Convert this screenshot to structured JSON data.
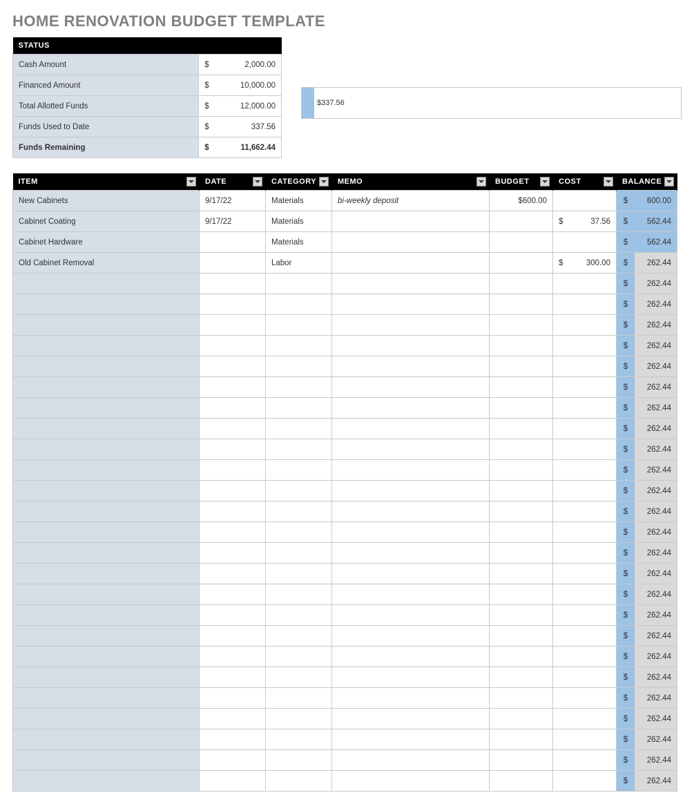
{
  "title": "HOME RENOVATION BUDGET TEMPLATE",
  "status": {
    "header": "STATUS",
    "rows": [
      {
        "label": "Cash Amount",
        "cur": "$",
        "value": "2,000.00",
        "bold": false
      },
      {
        "label": "Financed Amount",
        "cur": "$",
        "value": "10,000.00",
        "bold": false
      },
      {
        "label": "Total Allotted Funds",
        "cur": "$",
        "value": "12,000.00",
        "bold": false
      },
      {
        "label": "Funds Used to Date",
        "cur": "$",
        "value": "337.56",
        "bold": false
      },
      {
        "label": "Funds Remaining",
        "cur": "$",
        "value": "11,662.44",
        "bold": true
      }
    ]
  },
  "bar": {
    "label": "$337.56"
  },
  "columns": {
    "item": "ITEM",
    "date": "DATE",
    "category": "CATEGORY",
    "memo": "MEMO",
    "budget": "BUDGET",
    "cost": "COST",
    "balance": "BALANCE"
  },
  "rows": [
    {
      "item": "New Cabinets",
      "date": "9/17/22",
      "category": "Materials",
      "memo": "bi-weekly deposit",
      "budget": "$600.00",
      "cost_cur": "",
      "cost": "",
      "bal_cur": "$",
      "balance": "600.00",
      "full": true
    },
    {
      "item": "Cabinet Coating",
      "date": "9/17/22",
      "category": "Materials",
      "memo": "",
      "budget": "",
      "cost_cur": "$",
      "cost": "37.56",
      "bal_cur": "$",
      "balance": "562.44",
      "full": true
    },
    {
      "item": "Cabinet Hardware",
      "date": "",
      "category": "Materials",
      "memo": "",
      "budget": "",
      "cost_cur": "",
      "cost": "",
      "bal_cur": "$",
      "balance": "562.44",
      "full": true
    },
    {
      "item": "Old Cabinet Removal",
      "date": "",
      "category": "Labor",
      "memo": "",
      "budget": "",
      "cost_cur": "$",
      "cost": "300.00",
      "bal_cur": "$",
      "balance": "262.44",
      "full": false
    },
    {
      "item": "",
      "date": "",
      "category": "",
      "memo": "",
      "budget": "",
      "cost_cur": "",
      "cost": "",
      "bal_cur": "$",
      "balance": "262.44",
      "full": false
    },
    {
      "item": "",
      "date": "",
      "category": "",
      "memo": "",
      "budget": "",
      "cost_cur": "",
      "cost": "",
      "bal_cur": "$",
      "balance": "262.44",
      "full": false
    },
    {
      "item": "",
      "date": "",
      "category": "",
      "memo": "",
      "budget": "",
      "cost_cur": "",
      "cost": "",
      "bal_cur": "$",
      "balance": "262.44",
      "full": false
    },
    {
      "item": "",
      "date": "",
      "category": "",
      "memo": "",
      "budget": "",
      "cost_cur": "",
      "cost": "",
      "bal_cur": "$",
      "balance": "262.44",
      "full": false
    },
    {
      "item": "",
      "date": "",
      "category": "",
      "memo": "",
      "budget": "",
      "cost_cur": "",
      "cost": "",
      "bal_cur": "$",
      "balance": "262.44",
      "full": false
    },
    {
      "item": "",
      "date": "",
      "category": "",
      "memo": "",
      "budget": "",
      "cost_cur": "",
      "cost": "",
      "bal_cur": "$",
      "balance": "262.44",
      "full": false
    },
    {
      "item": "",
      "date": "",
      "category": "",
      "memo": "",
      "budget": "",
      "cost_cur": "",
      "cost": "",
      "bal_cur": "$",
      "balance": "262.44",
      "full": false
    },
    {
      "item": "",
      "date": "",
      "category": "",
      "memo": "",
      "budget": "",
      "cost_cur": "",
      "cost": "",
      "bal_cur": "$",
      "balance": "262.44",
      "full": false
    },
    {
      "item": "",
      "date": "",
      "category": "",
      "memo": "",
      "budget": "",
      "cost_cur": "",
      "cost": "",
      "bal_cur": "$",
      "balance": "262.44",
      "full": false
    },
    {
      "item": "",
      "date": "",
      "category": "",
      "memo": "",
      "budget": "",
      "cost_cur": "",
      "cost": "",
      "bal_cur": "$",
      "balance": "262.44",
      "full": false
    },
    {
      "item": "",
      "date": "",
      "category": "",
      "memo": "",
      "budget": "",
      "cost_cur": "",
      "cost": "",
      "bal_cur": "$",
      "balance": "262.44",
      "full": false
    },
    {
      "item": "",
      "date": "",
      "category": "",
      "memo": "",
      "budget": "",
      "cost_cur": "",
      "cost": "",
      "bal_cur": "$",
      "balance": "262.44",
      "full": false
    },
    {
      "item": "",
      "date": "",
      "category": "",
      "memo": "",
      "budget": "",
      "cost_cur": "",
      "cost": "",
      "bal_cur": "$",
      "balance": "262.44",
      "full": false
    },
    {
      "item": "",
      "date": "",
      "category": "",
      "memo": "",
      "budget": "",
      "cost_cur": "",
      "cost": "",
      "bal_cur": "$",
      "balance": "262.44",
      "full": false
    },
    {
      "item": "",
      "date": "",
      "category": "",
      "memo": "",
      "budget": "",
      "cost_cur": "",
      "cost": "",
      "bal_cur": "$",
      "balance": "262.44",
      "full": false
    },
    {
      "item": "",
      "date": "",
      "category": "",
      "memo": "",
      "budget": "",
      "cost_cur": "",
      "cost": "",
      "bal_cur": "$",
      "balance": "262.44",
      "full": false
    },
    {
      "item": "",
      "date": "",
      "category": "",
      "memo": "",
      "budget": "",
      "cost_cur": "",
      "cost": "",
      "bal_cur": "$",
      "balance": "262.44",
      "full": false
    },
    {
      "item": "",
      "date": "",
      "category": "",
      "memo": "",
      "budget": "",
      "cost_cur": "",
      "cost": "",
      "bal_cur": "$",
      "balance": "262.44",
      "full": false
    },
    {
      "item": "",
      "date": "",
      "category": "",
      "memo": "",
      "budget": "",
      "cost_cur": "",
      "cost": "",
      "bal_cur": "$",
      "balance": "262.44",
      "full": false
    },
    {
      "item": "",
      "date": "",
      "category": "",
      "memo": "",
      "budget": "",
      "cost_cur": "",
      "cost": "",
      "bal_cur": "$",
      "balance": "262.44",
      "full": false
    },
    {
      "item": "",
      "date": "",
      "category": "",
      "memo": "",
      "budget": "",
      "cost_cur": "",
      "cost": "",
      "bal_cur": "$",
      "balance": "262.44",
      "full": false
    },
    {
      "item": "",
      "date": "",
      "category": "",
      "memo": "",
      "budget": "",
      "cost_cur": "",
      "cost": "",
      "bal_cur": "$",
      "balance": "262.44",
      "full": false
    },
    {
      "item": "",
      "date": "",
      "category": "",
      "memo": "",
      "budget": "",
      "cost_cur": "",
      "cost": "",
      "bal_cur": "$",
      "balance": "262.44",
      "full": false
    },
    {
      "item": "",
      "date": "",
      "category": "",
      "memo": "",
      "budget": "",
      "cost_cur": "",
      "cost": "",
      "bal_cur": "$",
      "balance": "262.44",
      "full": false
    },
    {
      "item": "",
      "date": "",
      "category": "",
      "memo": "",
      "budget": "",
      "cost_cur": "",
      "cost": "",
      "bal_cur": "$",
      "balance": "262.44",
      "full": false
    }
  ],
  "chart_data": {
    "type": "bar",
    "title": "",
    "categories": [
      "Funds Used to Date"
    ],
    "values": [
      337.56
    ],
    "xlim": [
      0,
      12000
    ],
    "xlabel": "",
    "ylabel": ""
  }
}
